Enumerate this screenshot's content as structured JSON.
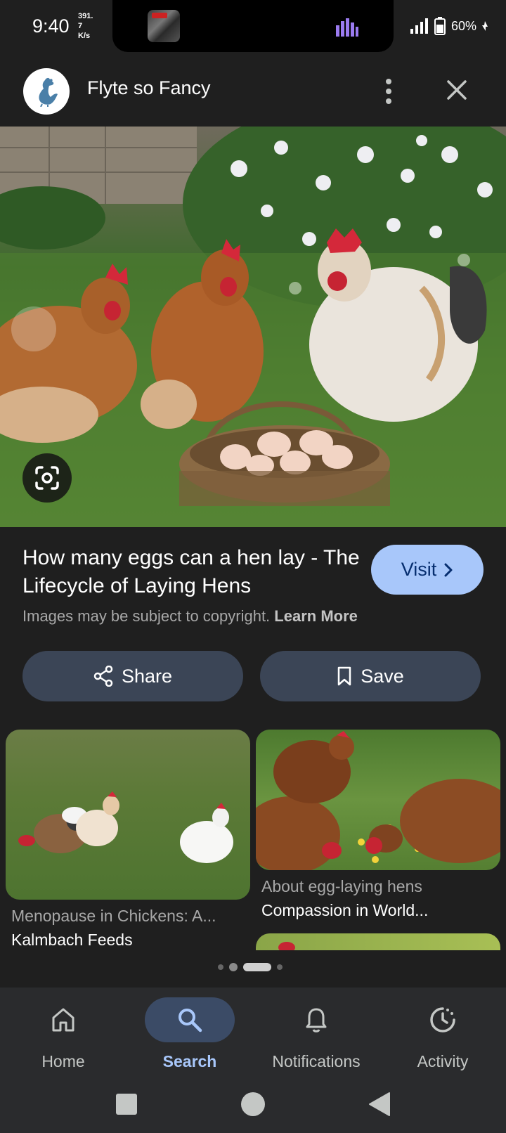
{
  "status_bar": {
    "time": "9:40",
    "net_speed_1": "391.",
    "net_speed_2": "7",
    "net_speed_unit": "K/s",
    "battery": "60%"
  },
  "header": {
    "site_name": "Flyte so Fancy",
    "logo_icon": "rooster-icon",
    "more_icon": "more-vert-icon",
    "close_icon": "close-icon"
  },
  "result": {
    "title": "How many eggs can a hen lay - The Lifecycle of Laying Hens",
    "visit_label": "Visit",
    "copyright_text": "Images may be subject to copyright.",
    "learn_more": "Learn More"
  },
  "actions": {
    "share_label": "Share",
    "save_label": "Save"
  },
  "related": [
    {
      "title": "Menopause in Chickens: A...",
      "source": "Kalmbach Feeds"
    },
    {
      "title": "About egg-laying hens",
      "source": "Compassion in World..."
    }
  ],
  "bottom_nav": [
    {
      "label": "Home",
      "icon": "home-icon",
      "active": false
    },
    {
      "label": "Search",
      "icon": "search-icon",
      "active": true
    },
    {
      "label": "Notifications",
      "icon": "bell-icon",
      "active": false
    },
    {
      "label": "Activity",
      "icon": "activity-icon",
      "active": false
    }
  ],
  "colors": {
    "accent": "#a8c7fa",
    "button_bg": "#3b4556",
    "background": "#1f1f1f"
  }
}
